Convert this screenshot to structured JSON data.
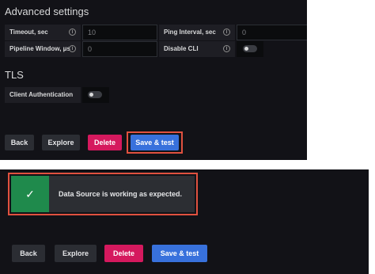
{
  "advanced": {
    "title": "Advanced settings",
    "timeout": {
      "label": "Timeout, sec",
      "value": "10"
    },
    "ping_interval": {
      "label": "Ping Interval, sec",
      "value": "0"
    },
    "pipeline_window": {
      "label": "Pipeline Window, μs",
      "value": "0"
    },
    "disable_cli": {
      "label": "Disable CLI",
      "enabled": false
    }
  },
  "tls": {
    "title": "TLS",
    "client_auth": {
      "label": "Client Authentication",
      "enabled": false
    }
  },
  "buttons": {
    "back": "Back",
    "explore": "Explore",
    "delete": "Delete",
    "save_test": "Save & test"
  },
  "alert": {
    "message": "Data Source is working as expected.",
    "icon": "check-icon"
  },
  "info_glyph": "i",
  "check_glyph": "✓",
  "colors": {
    "panel_bg": "#121217",
    "primary": "#3871dc",
    "destructive": "#d5195e",
    "success": "#1f8a4c",
    "highlight": "#e0513f"
  }
}
